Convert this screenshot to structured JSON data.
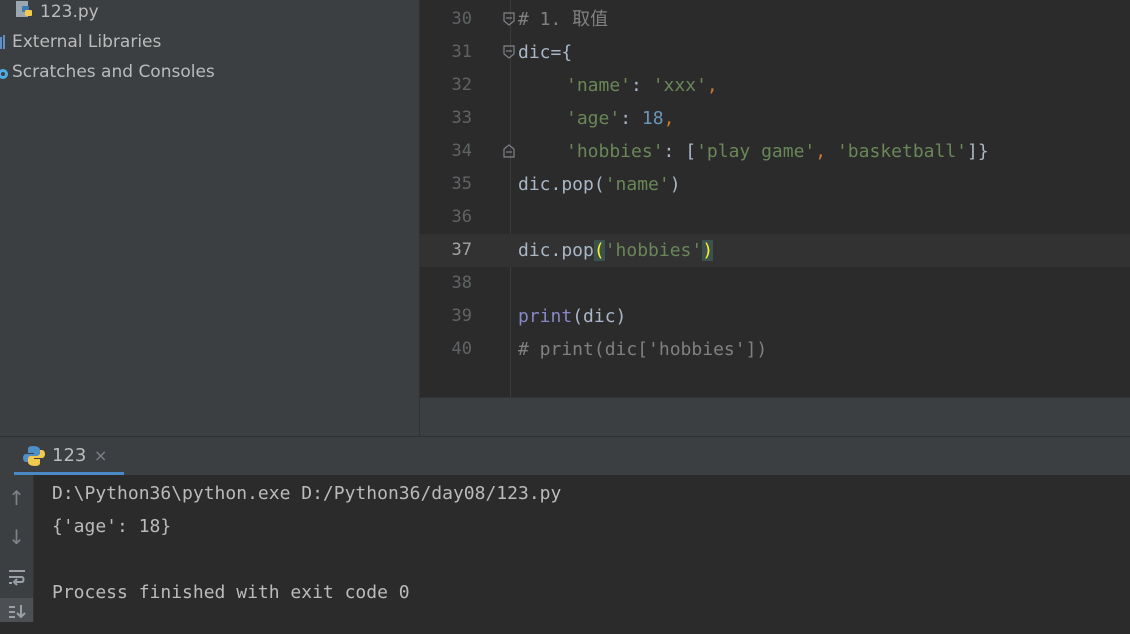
{
  "project_tree": {
    "items": [
      {
        "label": "123.py",
        "icon": "python-file-icon"
      },
      {
        "label": "External Libraries",
        "icon": "library-icon"
      },
      {
        "label": "Scratches and Consoles",
        "icon": "scratches-icon"
      }
    ]
  },
  "editor": {
    "lines": [
      {
        "num": "30",
        "comment": "# 1. 取值"
      },
      {
        "num": "31",
        "ident": "dic",
        "op": "=",
        "brace": "{"
      },
      {
        "num": "32",
        "key": "'name'",
        "colon": ": ",
        "val": "'xxx'",
        "comma": ","
      },
      {
        "num": "33",
        "key": "'age'",
        "colon": ": ",
        "val": "18",
        "comma": ","
      },
      {
        "num": "34",
        "key": "'hobbies'",
        "colon": ": [",
        "v1": "'play game'",
        "comma": ", ",
        "v2": "'basketball'",
        "end": "]}"
      },
      {
        "num": "35",
        "pre": "dic.pop(",
        "arg": "'name'",
        "post": ")"
      },
      {
        "num": "36"
      },
      {
        "num": "37",
        "pre": "dic.pop",
        "open": "(",
        "arg": "'hobbies'",
        "close": ")"
      },
      {
        "num": "38"
      },
      {
        "num": "39",
        "fn": "print",
        "rest": "(dic)"
      },
      {
        "num": "40",
        "comment": "# print(dic['hobbies'])"
      }
    ]
  },
  "run_panel": {
    "tab_label": "123",
    "tab_close": "×",
    "console_lines": [
      "D:\\Python36\\python.exe D:/Python36/day08/123.py",
      "{'age': 18}",
      "",
      "Process finished with exit code 0"
    ],
    "toolbar": {
      "up": "↑",
      "down": "↓"
    }
  }
}
